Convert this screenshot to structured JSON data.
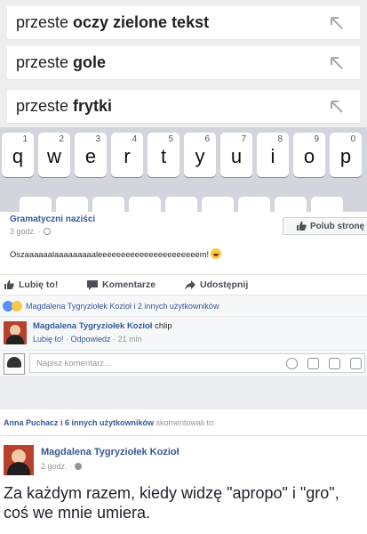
{
  "suggestions": [
    {
      "prefix": "przeste ",
      "bold": "oczy zielone tekst"
    },
    {
      "prefix": "przeste ",
      "bold": "gole"
    },
    {
      "prefix": "przeste ",
      "bold": "frytki"
    }
  ],
  "keyboard": {
    "keys": [
      {
        "char": "q",
        "num": "1"
      },
      {
        "char": "w",
        "num": "2"
      },
      {
        "char": "e",
        "num": "3"
      },
      {
        "char": "r",
        "num": "4"
      },
      {
        "char": "t",
        "num": "5"
      },
      {
        "char": "y",
        "num": "6"
      },
      {
        "char": "u",
        "num": "7"
      },
      {
        "char": "i",
        "num": "8"
      },
      {
        "char": "o",
        "num": "9"
      },
      {
        "char": "p",
        "num": "0"
      }
    ]
  },
  "post": {
    "page_name": "Gramatyczni naziści",
    "meta": "3 godz. · ",
    "like_page_label": "Polub stronę",
    "text": "Oszaaaaaalaaaaaaaaaleeeeeeeeeeeeeeeeeeeeeem!",
    "actions": {
      "like": "Lubię to!",
      "comment": "Komentarze",
      "share": "Udostępnij"
    },
    "reactions_text": "Magdalena Tygryziołek Kozioł i 2 innych użytkowników"
  },
  "comment": {
    "author": "Magdalena Tygryziołek Kozioł",
    "text": " chlip",
    "like": "Lubię to!",
    "reply": "Odpowiedz",
    "time": "21 min"
  },
  "write_comment": {
    "placeholder": "Napisz komentarz..."
  },
  "shares": {
    "link": "Anna Puchacz i 6 innych użytkowników",
    "rest": " skomentowali to."
  },
  "post2": {
    "author": "Magdalena Tygryziołek Kozioł",
    "meta": "2 godz. · ",
    "text": "Za każdym razem, kiedy widzę \"apropo\" i \"gro\", coś we mnie umiera."
  }
}
